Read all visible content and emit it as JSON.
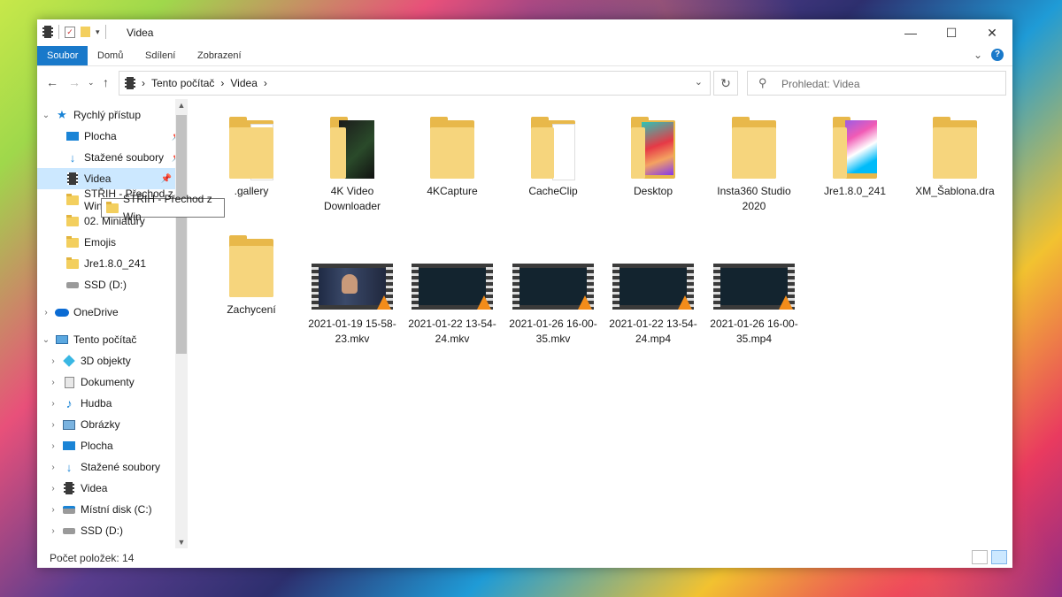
{
  "window": {
    "title": "Videa",
    "controls": {
      "minimize": "—",
      "maximize": "☐",
      "close": "✕"
    }
  },
  "ribbon": {
    "tabs": [
      "Soubor",
      "Domů",
      "Sdílení",
      "Zobrazení"
    ],
    "help": "?"
  },
  "address": {
    "crumbs": [
      "Tento počítač",
      "Videa"
    ],
    "dropdown": "⌄",
    "refresh": "↻"
  },
  "search": {
    "placeholder": "Prohledat: Videa",
    "icon": "search-icon"
  },
  "sidebar": {
    "quick_access": "Rychlý přístup",
    "quick_items": [
      "Plocha",
      "Stažené soubory",
      "Videa",
      "STŘIH - Přechod z Win",
      "02. Miniatury",
      "Emojis",
      "Jre1.8.0_241",
      "SSD (D:)"
    ],
    "onedrive": "OneDrive",
    "this_pc": "Tento počítač",
    "pc_items": [
      "3D objekty",
      "Dokumenty",
      "Hudba",
      "Obrázky",
      "Plocha",
      "Stažené soubory",
      "Videa",
      "Místní disk (C:)",
      "SSD (D:)"
    ],
    "tooltip": "STŘIH - Přechod z Win"
  },
  "files": [
    {
      "name": ".gallery",
      "type": "folder"
    },
    {
      "name": "4K Video Downloader",
      "type": "folder-dark"
    },
    {
      "name": "4KCapture",
      "type": "folder"
    },
    {
      "name": "CacheClip",
      "type": "folder-doc"
    },
    {
      "name": "Desktop",
      "type": "folder-color"
    },
    {
      "name": "Insta360 Studio 2020",
      "type": "folder"
    },
    {
      "name": "Jre1.8.0_241",
      "type": "folder-color2"
    },
    {
      "name": "XM_Šablona.dra",
      "type": "folder"
    },
    {
      "name": "Zachycení",
      "type": "folder"
    },
    {
      "name": "2021-01-19 15-58-23.mkv",
      "type": "video-person"
    },
    {
      "name": "2021-01-22 13-54-24.mkv",
      "type": "video"
    },
    {
      "name": "2021-01-26 16-00-35.mkv",
      "type": "video"
    },
    {
      "name": "2021-01-22 13-54-24.mp4",
      "type": "video"
    },
    {
      "name": "2021-01-26 16-00-35.mp4",
      "type": "video"
    }
  ],
  "status": {
    "count": "Počet položek: 14"
  }
}
